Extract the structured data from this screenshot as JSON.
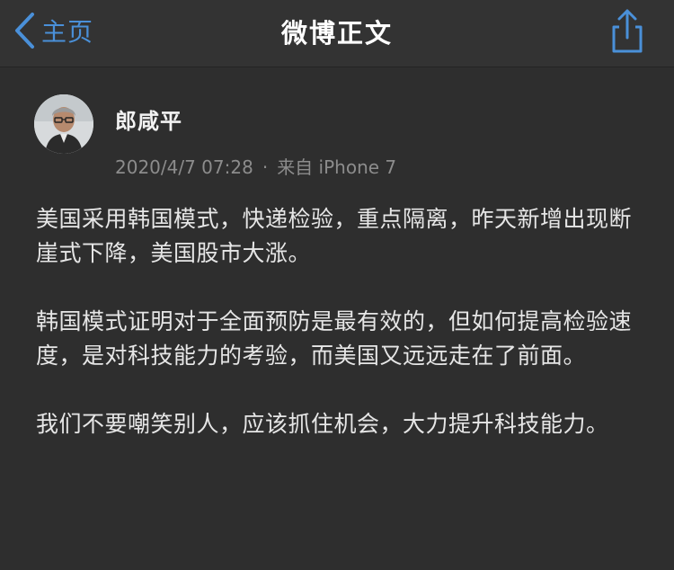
{
  "navbar": {
    "back_label": "主页",
    "title": "微博正文"
  },
  "post": {
    "author": "郎咸平",
    "timestamp": "2020/4/7 07:28",
    "separator": "·",
    "source": "来自 iPhone 7",
    "paragraphs": [
      "美国采用韩国模式，快递检验，重点隔离，昨天新增出现断崖式下降，美国股市大涨。",
      "韩国模式证明对于全面预防是最有效的，但如何提高检验速度，是对科技能力的考验，而美国又远远走在了前面。",
      "我们不要嘲笑别人，应该抓住机会，大力提升科技能力。"
    ]
  },
  "colors": {
    "accent": "#4a90d9",
    "background": "#2e2e2e",
    "navbar": "#333333",
    "meta_text": "#8c8c8c"
  },
  "icons": {
    "back": "chevron-left-icon",
    "share": "share-icon"
  }
}
